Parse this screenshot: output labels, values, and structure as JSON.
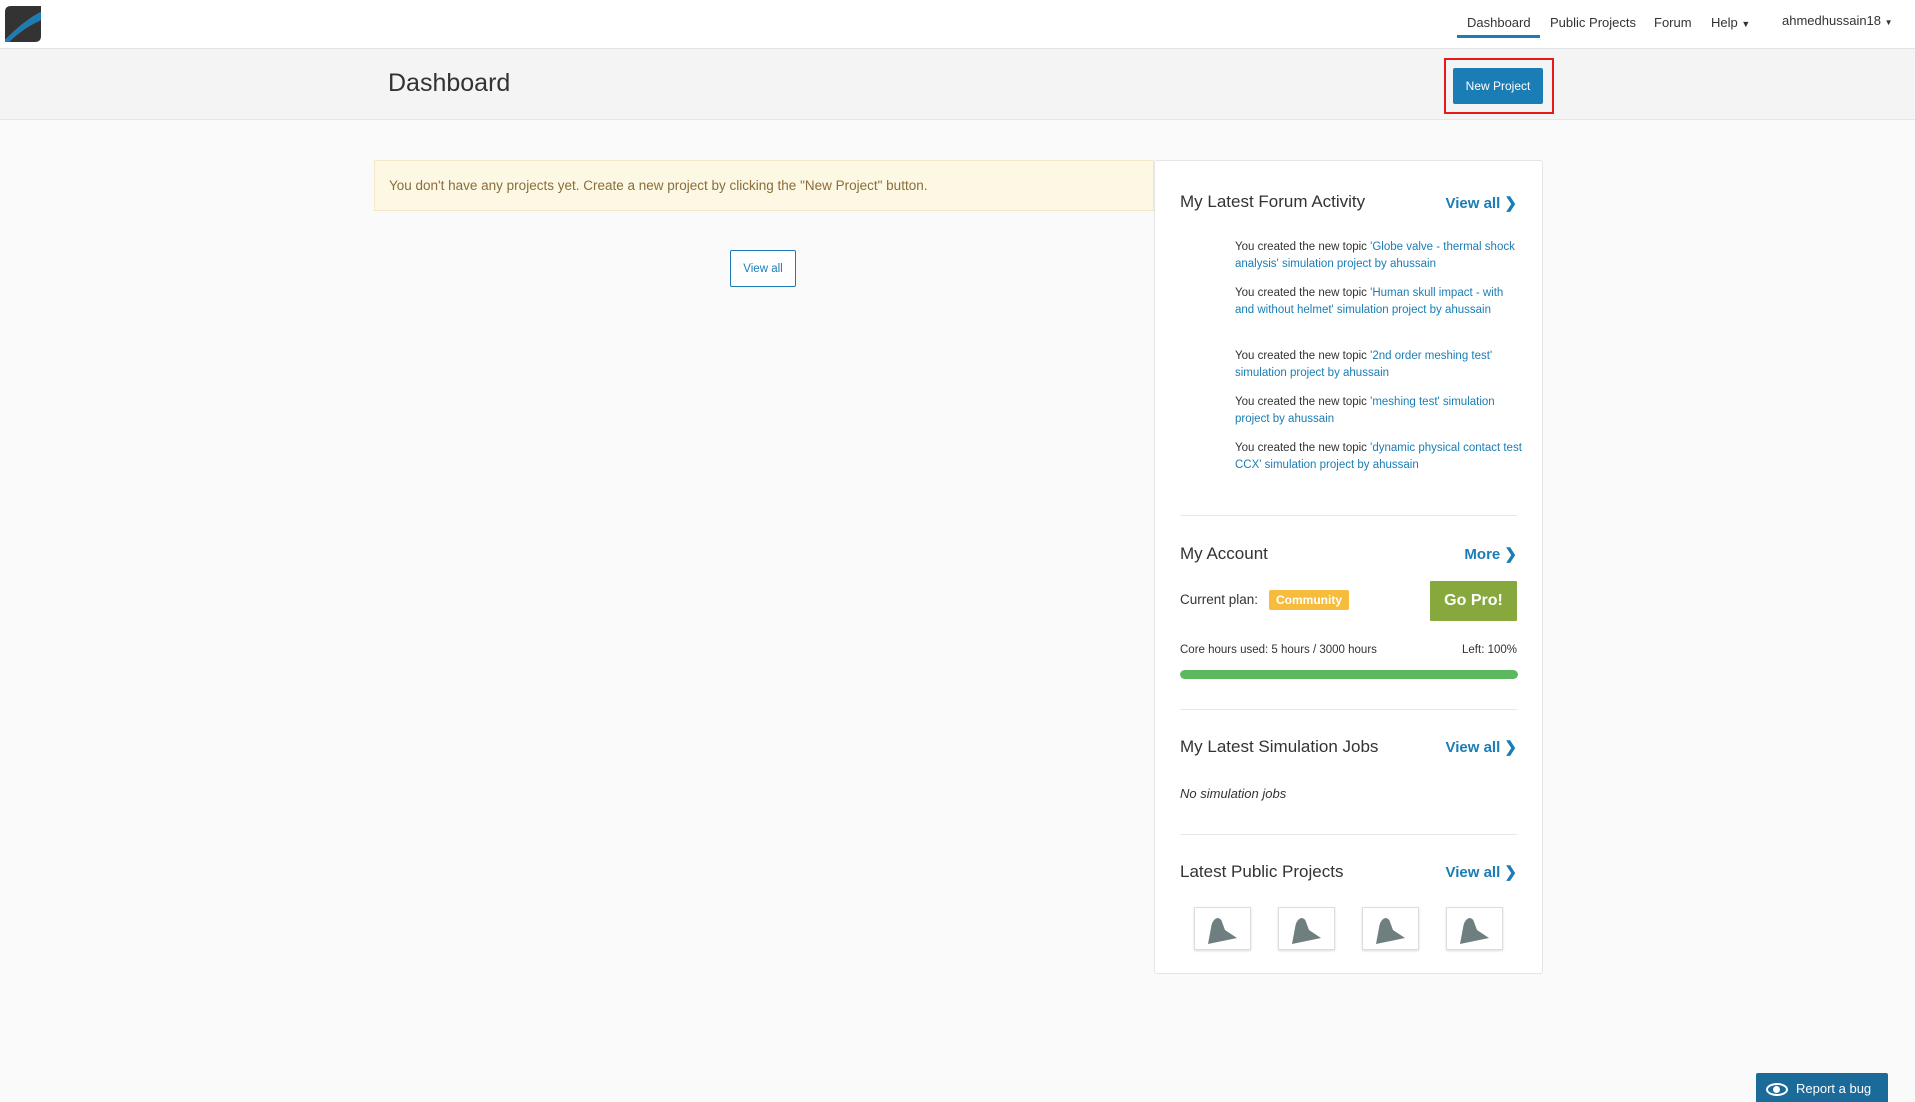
{
  "nav": {
    "items": [
      "Dashboard",
      "Public Projects",
      "Forum",
      "Help"
    ],
    "user": "ahmedhussain18"
  },
  "header": {
    "title": "Dashboard",
    "new_project": "New Project"
  },
  "alert": "You don't have any projects yet. Create a new project by clicking the \"New Project\" button.",
  "projects_view_all": "View all",
  "forum": {
    "title": "My Latest Forum Activity",
    "view_all": "View all",
    "items": [
      {
        "prefix": "You created the new topic ",
        "topic": "'Globe valve - thermal shock analysis' simulation project by ahussain"
      },
      {
        "prefix": "You created the new topic ",
        "topic": "'Human skull impact - with and without helmet' simulation project by ahussain"
      },
      {
        "prefix": "You created the new topic ",
        "topic": "'2nd order meshing test' simulation project by ahussain"
      },
      {
        "prefix": "You created the new topic ",
        "topic": "'meshing test' simulation project by ahussain"
      },
      {
        "prefix": "You created the new topic ",
        "topic": "'dynamic physical contact test CCX' simulation project by ahussain"
      }
    ]
  },
  "account": {
    "title": "My Account",
    "more": "More",
    "plan_label": "Current plan:",
    "plan": "Community",
    "go_pro": "Go Pro!",
    "core_hours": "Core hours used: 5 hours / 3000 hours",
    "left": "Left: 100%",
    "left_fraction": 1.0
  },
  "jobs": {
    "title": "My Latest Simulation Jobs",
    "view_all": "View all",
    "empty": "No simulation jobs"
  },
  "public": {
    "title": "Latest Public Projects",
    "view_all": "View all",
    "count": 4
  },
  "report_bug": "Report a bug",
  "colors": {
    "primary": "#1a7db5",
    "plan": "#f7bc3c",
    "gopro": "#86a83d",
    "progress": "#5cb85c"
  }
}
